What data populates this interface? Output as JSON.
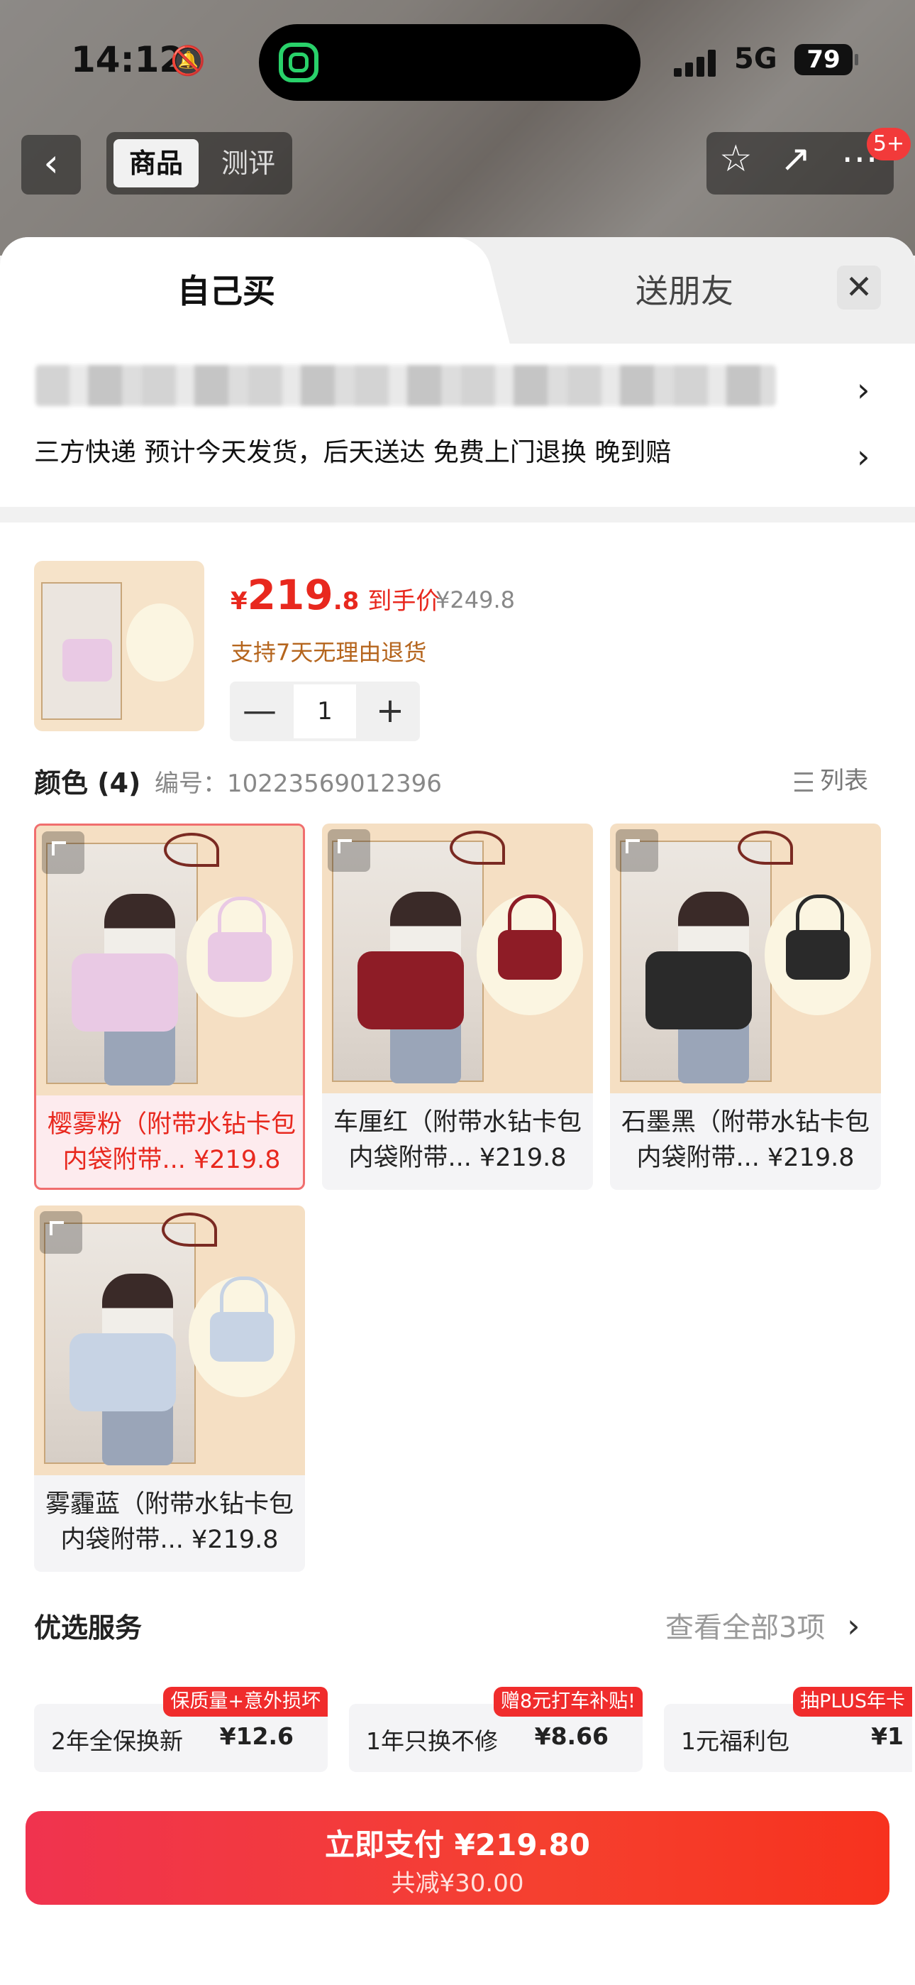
{
  "status_bar": {
    "time": "14:12",
    "network": "5G",
    "battery": "79"
  },
  "top_nav": {
    "seg_active": "商品",
    "seg_inactive": "测评",
    "badge": "5+"
  },
  "sheet": {
    "tab_active": "自己买",
    "tab_gift": "送朋友",
    "delivery": "三方快递 预计今天发货，后天送达 免费上门退换  晚到赔"
  },
  "product": {
    "currency": "¥",
    "price_int": "219",
    "price_dec": ".8",
    "price_label": "到手价",
    "original_price": "¥249.8",
    "returns": "支持7天无理由退货",
    "quantity": "1",
    "minus": "—",
    "plus": "+"
  },
  "colors": {
    "title": "颜色 (4)",
    "code": "编号：10223569012396",
    "list_label": "列表",
    "items": [
      {
        "label": "樱雾粉（附带水钻卡包 内袋附带... ¥219.8",
        "bag_color": "#e9c9e4",
        "selected": true
      },
      {
        "label": "车厘红（附带水钻卡包 内袋附带... ¥219.8",
        "bag_color": "#8e1c26",
        "selected": false
      },
      {
        "label": "石墨黑（附带水钻卡包 内袋附带... ¥219.8",
        "bag_color": "#2a2a2a",
        "selected": false
      },
      {
        "label": "雾霾蓝（附带水钻卡包 内袋附带... ¥219.8",
        "bag_color": "#c7d3e4",
        "selected": false
      }
    ]
  },
  "services": {
    "title": "优选服务",
    "view_all": "查看全部3项",
    "items": [
      {
        "name": "2年全保换新",
        "price": "¥12.6",
        "tag": "保质量+意外损坏"
      },
      {
        "name": "1年只换不修",
        "price": "¥8.66",
        "tag": "赠8元打车补贴!"
      },
      {
        "name": "1元福利包",
        "price": "¥1",
        "tag": "抽PLUS年卡"
      }
    ]
  },
  "pay": {
    "main": "立即支付 ¥219.80",
    "sub": "共减¥30.00"
  }
}
